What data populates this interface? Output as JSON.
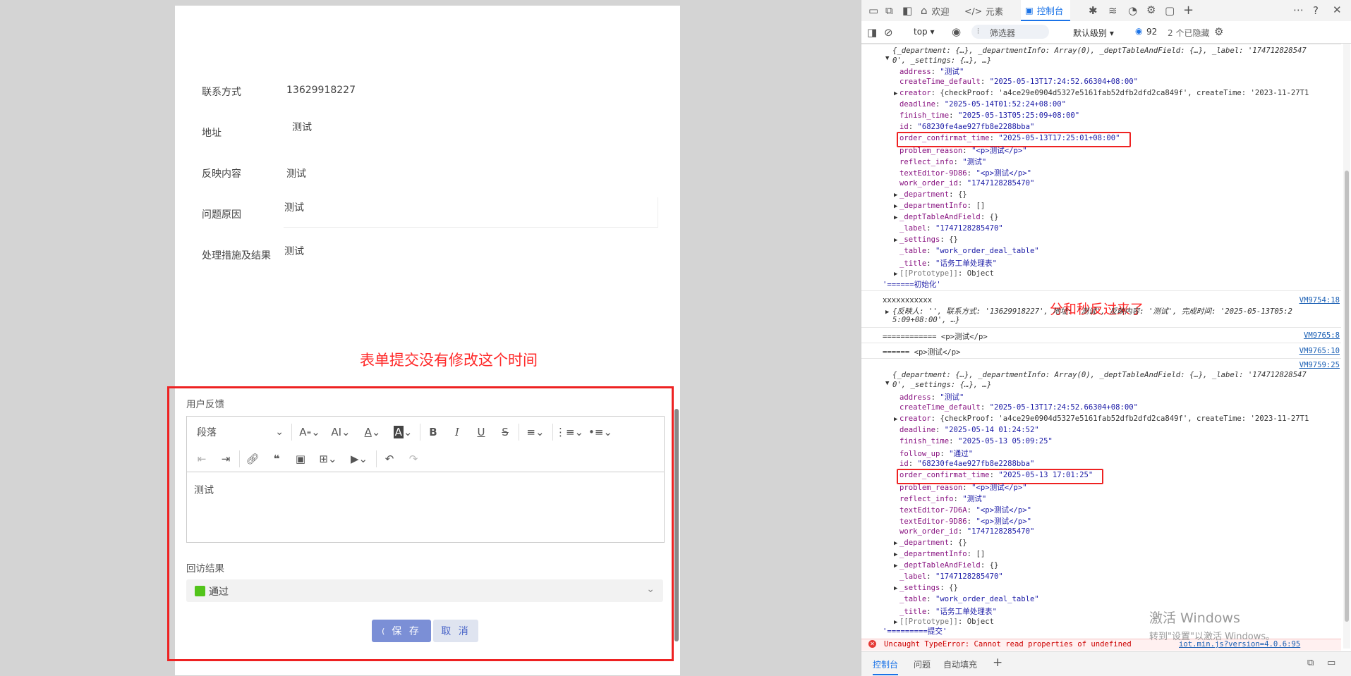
{
  "form": {
    "contact_label": "联系方式",
    "contact_value": "13629918227",
    "address_label": "地址",
    "address_value": "测试",
    "reflect_label": "反映内容",
    "reflect_value": "测试",
    "reason_label": "问题原因",
    "reason_value": "测试",
    "measure_label": "处理措施及结果",
    "measure_value": "测试"
  },
  "annotation_left": "表单提交没有修改这个时间",
  "annotation_right": "分和秒反过来了",
  "feedback": {
    "section_label": "用户反馈",
    "paragraph_select": "段落",
    "body_text": "测试"
  },
  "toolbar_icons": [
    "font-size-icon",
    "line-height-icon",
    "font-color-icon",
    "bg-color-icon",
    "bold-icon",
    "italic-icon",
    "underline-icon",
    "strikethrough-icon",
    "align-icon",
    "ordered-list-icon",
    "bullet-list-icon",
    "outdent-icon",
    "indent-icon",
    "link-icon",
    "quote-icon",
    "image-icon",
    "table-icon",
    "video-icon",
    "undo-icon",
    "redo-icon"
  ],
  "visit_result": {
    "label": "回访结果",
    "selected": "通过",
    "color": "#52c41a"
  },
  "buttons": {
    "save": "保 存",
    "save_prefix": "(",
    "cancel": "取 消"
  },
  "devtools": {
    "tabs": [
      "欢迎",
      "元素",
      "控制台"
    ],
    "context": "top",
    "filter_placeholder": "筛选器",
    "level": "默认级别",
    "issues_count": "92",
    "hidden": "2 个已隐藏",
    "bottom_tabs": [
      "控制台",
      "问题",
      "自动填充"
    ]
  },
  "console": {
    "obj1_summary_a": "{_department: {…}, _departmentInfo: Array(0), _deptTableAndField: {…}, _label: '174712828547",
    "obj1_summary_b": "0', _settings: {…}, …}",
    "obj1": [
      {
        "k": "address",
        "v": "\"测试\""
      },
      {
        "k": "createTime_default",
        "v": "\"2025-05-13T17:24:52.66304+08:00\""
      },
      {
        "k": "creator",
        "v": "{checkProof: 'a4ce29e0904d5327e5161fab52dfb2dfd2ca849f', createTime: '2023-11-27T1"
      },
      {
        "k": "deadline",
        "v": "\"2025-05-14T01:52:24+08:00\""
      },
      {
        "k": "finish_time",
        "v": "\"2025-05-13T05:25:09+08:00\""
      },
      {
        "k": "id",
        "v": "\"68230fe4ae927fb8e2288bba\""
      },
      {
        "k": "order_confirmat_time",
        "v": "\"2025-05-13T17:25:01+08:00\""
      },
      {
        "k": "problem_reason",
        "v": "\"<p>测试</p>\""
      },
      {
        "k": "reflect_info",
        "v": "\"测试\""
      },
      {
        "k": "textEditor-9D86",
        "v": "\"<p>测试</p>\""
      },
      {
        "k": "work_order_id",
        "v": "\"1747128285470\""
      },
      {
        "k": "_department",
        "v": "{}"
      },
      {
        "k": "_departmentInfo",
        "v": "[]"
      },
      {
        "k": "_deptTableAndField",
        "v": "{}"
      },
      {
        "k": "_label",
        "v": "\"1747128285470\""
      },
      {
        "k": "_settings",
        "v": "{}"
      },
      {
        "k": "_table",
        "v": "\"work_order_deal_table\""
      },
      {
        "k": "_title",
        "v": "\"话务工单处理表\""
      },
      {
        "k": "[[Prototype]]",
        "v": "Object"
      }
    ],
    "init_line": "'======初始化'",
    "xline": "xxxxxxxxxxx",
    "xline_link": "VM9754:18",
    "obj2_a": "{反映人: '', 联系方式: '13629918227', 地址: '测试', 反映内容: '测试', 完成时间: '2025-05-13T05:2",
    "obj2_b": "5:09+08:00', …}",
    "p_line1": "============ <p>测试</p>",
    "p_line1_link": "VM9765:8",
    "p_line2": "====== <p>测试</p>",
    "p_line2_link": "VM9765:10",
    "obj3_link": "VM9759:25",
    "obj3_summary_a": "{_department: {…}, _departmentInfo: Array(0), _deptTableAndField: {…}, _label: '174712828547",
    "obj3_summary_b": "0', _settings: {…}, …}",
    "obj3": [
      {
        "k": "address",
        "v": "\"测试\""
      },
      {
        "k": "createTime_default",
        "v": "\"2025-05-13T17:24:52.66304+08:00\""
      },
      {
        "k": "creator",
        "v": "{checkProof: 'a4ce29e0904d5327e5161fab52dfb2dfd2ca849f', createTime: '2023-11-27T1"
      },
      {
        "k": "deadline",
        "v": "\"2025-05-14 01:24:52\""
      },
      {
        "k": "finish_time",
        "v": "\"2025-05-13 05:09:25\""
      },
      {
        "k": "follow_up",
        "v": "\"通过\""
      },
      {
        "k": "id",
        "v": "\"68230fe4ae927fb8e2288bba\""
      },
      {
        "k": "order_confirmat_time",
        "v": "\"2025-05-13 17:01:25\""
      },
      {
        "k": "problem_reason",
        "v": "\"<p>测试</p>\""
      },
      {
        "k": "reflect_info",
        "v": "\"测试\""
      },
      {
        "k": "textEditor-7D6A",
        "v": "\"<p>测试</p>\""
      },
      {
        "k": "textEditor-9D86",
        "v": "\"<p>测试</p>\""
      },
      {
        "k": "work_order_id",
        "v": "\"1747128285470\""
      },
      {
        "k": "_department",
        "v": "{}"
      },
      {
        "k": "_departmentInfo",
        "v": "[]"
      },
      {
        "k": "_deptTableAndField",
        "v": "{}"
      },
      {
        "k": "_label",
        "v": "\"1747128285470\""
      },
      {
        "k": "_settings",
        "v": "{}"
      },
      {
        "k": "_table",
        "v": "\"work_order_deal_table\""
      },
      {
        "k": "_title",
        "v": "\"话务工单处理表\""
      },
      {
        "k": "[[Prototype]]",
        "v": "Object"
      }
    ],
    "submit_line": "'=========提交'",
    "error_line": "Uncaught TypeError: Cannot read properties of undefined",
    "error_link": "iot.min.js?version=4.0.6:95"
  },
  "watermark": {
    "line1": "激活 Windows",
    "line2": "转到\"设置\"以激活 Windows。"
  }
}
